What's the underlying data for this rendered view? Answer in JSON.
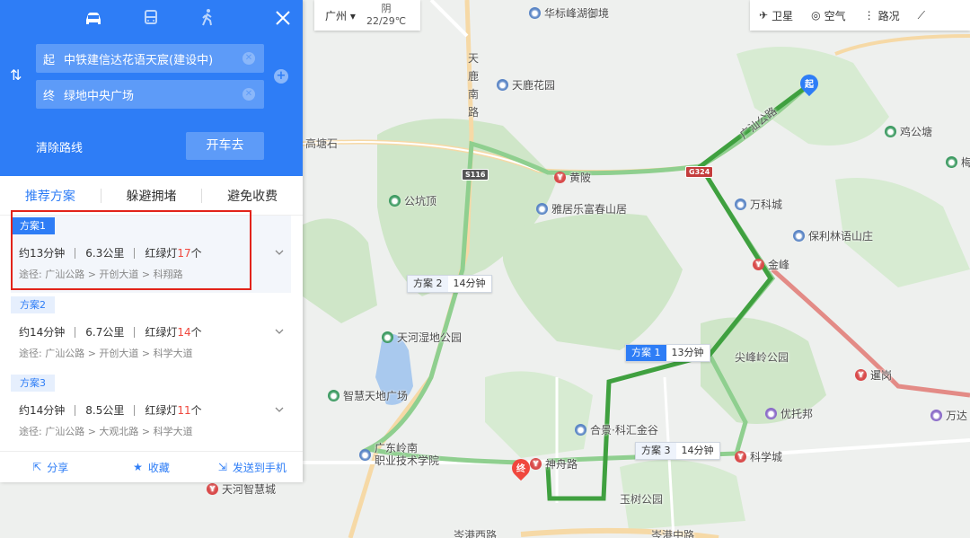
{
  "panel": {
    "start": {
      "label": "起",
      "value": "中铁建信达花语天宸(建设中)"
    },
    "end": {
      "label": "终",
      "value": "绿地中央广场"
    },
    "clear_label": "清除路线",
    "drive_label": "开车去",
    "tabs": [
      "推荐方案",
      "躲避拥堵",
      "避免收费"
    ],
    "plans": [
      {
        "badge": "方案1",
        "time": "约13分钟",
        "distance": "6.3公里",
        "lights_prefix": "红绿灯",
        "lights": "17",
        "lights_suffix": "个",
        "via_prefix": "途径:",
        "via": "广汕公路 > 开创大道 > 科翔路"
      },
      {
        "badge": "方案2",
        "time": "约14分钟",
        "distance": "6.7公里",
        "lights_prefix": "红绿灯",
        "lights": "14",
        "lights_suffix": "个",
        "via_prefix": "途径:",
        "via": "广汕公路 > 开创大道 > 科学大道"
      },
      {
        "badge": "方案3",
        "time": "约14分钟",
        "distance": "8.5公里",
        "lights_prefix": "红绿灯",
        "lights": "11",
        "lights_suffix": "个",
        "via_prefix": "途径:",
        "via": "广汕公路 > 大观北路 > 科学大道"
      }
    ],
    "actions": [
      "分享",
      "收藏",
      "发送到手机"
    ]
  },
  "city_bar": {
    "city": "广州",
    "weather": "阴",
    "temp": "22/29℃"
  },
  "toolbar": {
    "satellite": "卫星",
    "air": "空气",
    "traffic": "路况"
  },
  "map": {
    "pois": {
      "huabiao": "华标峰湖御境",
      "tianlu_garden": "天鹿花园",
      "huangpo": "黄陂",
      "gonggeng": "公坑顶",
      "yaju": "雅居乐富春山居",
      "vanke": "万科城",
      "baoli": "保利林语山庄",
      "jinfeng": "金峰",
      "jigongtang": "鸡公塘",
      "tianhe_wetland": "天河湿地公园",
      "zhihui_park": "智慧天地广场",
      "hejing": "合景·科汇金谷",
      "youtuobang": "优托邦",
      "jianfeng_park": "尖峰岭公园",
      "luogang": "暹岗",
      "college": "广东岭南\n职业技术学院",
      "shenzhou": "神舟路",
      "kexue": "科学城",
      "yushu_park": "玉树公园",
      "tianhe_smart": "天河智慧城",
      "wanda": "万达",
      "mei": "梅",
      "gaotang": "高塘石"
    },
    "road_labels": {
      "tianlu_road": "天鹿南路",
      "guangshan": "广汕公路",
      "bottom_left": "岑港西路",
      "bottom_right": "岑港中路"
    },
    "shields": {
      "s116": "S116",
      "g324": "G324"
    },
    "route_tags": [
      {
        "name": "方案 3",
        "time": "14分钟"
      },
      {
        "name": "方案 1",
        "time": "13分钟"
      },
      {
        "name": "方案 2",
        "time": "14分钟"
      }
    ],
    "start_pin": "起",
    "end_pin": "终"
  }
}
